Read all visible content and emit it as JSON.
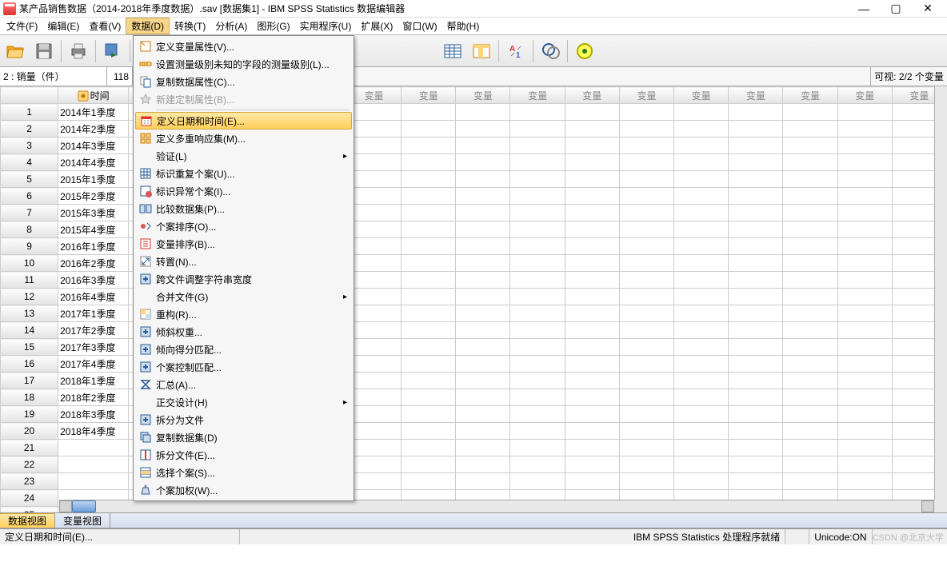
{
  "title": "某产品销售数据（2014-2018年季度数据）.sav [数据集1] - IBM SPSS Statistics 数据编辑器",
  "menubar": [
    "文件(F)",
    "编辑(E)",
    "查看(V)",
    "数据(D)",
    "转换(T)",
    "分析(A)",
    "图形(G)",
    "实用程序(U)",
    "扩展(X)",
    "窗口(W)",
    "帮助(H)"
  ],
  "locator": {
    "ref": "2 : 销量（件）",
    "val": "118",
    "vis": "可视: 2/2 个变量"
  },
  "columns": {
    "time": "时间",
    "var": "变量"
  },
  "rows": [
    "2014年1季度",
    "2014年2季度",
    "2014年3季度",
    "2014年4季度",
    "2015年1季度",
    "2015年2季度",
    "2015年3季度",
    "2015年4季度",
    "2016年1季度",
    "2016年2季度",
    "2016年3季度",
    "2016年4季度",
    "2017年1季度",
    "2017年2季度",
    "2017年3季度",
    "2017年4季度",
    "2018年1季度",
    "2018年2季度",
    "2018年3季度",
    "2018年4季度"
  ],
  "dropdown": [
    {
      "label": "定义变量属性(V)...",
      "icon": "props"
    },
    {
      "label": "设置测量级别未知的字段的测量级别(L)...",
      "icon": "ruler"
    },
    {
      "label": "复制数据属性(C)...",
      "icon": "copy"
    },
    {
      "label": "新建定制属性(B)...",
      "icon": "star",
      "disabled": true
    },
    {
      "sep": true
    },
    {
      "label": "定义日期和时间(E)...",
      "icon": "calendar",
      "highlight": true
    },
    {
      "label": "定义多重响应集(M)...",
      "icon": "multi"
    },
    {
      "label": "验证(L)",
      "sub": true,
      "noicon": true
    },
    {
      "label": "标识重复个案(U)...",
      "icon": "grid"
    },
    {
      "label": "标识异常个案(I)...",
      "icon": "warn"
    },
    {
      "label": "比较数据集(P)...",
      "icon": "compare"
    },
    {
      "label": "个案排序(O)...",
      "icon": "sort"
    },
    {
      "label": "变量排序(B)...",
      "icon": "sortv"
    },
    {
      "label": "转置(N)...",
      "icon": "transpose"
    },
    {
      "label": "跨文件调整字符串宽度",
      "icon": "plus"
    },
    {
      "label": "合并文件(G)",
      "sub": true,
      "noicon": true
    },
    {
      "label": "重构(R)...",
      "icon": "restruct"
    },
    {
      "label": "倾斜权重...",
      "icon": "plus"
    },
    {
      "label": "倾向得分匹配...",
      "icon": "plus"
    },
    {
      "label": "个案控制匹配...",
      "icon": "plus"
    },
    {
      "label": "汇总(A)...",
      "icon": "agg"
    },
    {
      "label": "正交设计(H)",
      "sub": true,
      "noicon": true
    },
    {
      "label": "拆分为文件",
      "icon": "plus"
    },
    {
      "label": "复制数据集(D)",
      "icon": "copyds"
    },
    {
      "label": "拆分文件(E)...",
      "icon": "split"
    },
    {
      "label": "选择个案(S)...",
      "icon": "select"
    },
    {
      "label": "个案加权(W)...",
      "icon": "weight"
    }
  ],
  "tabs": {
    "data": "数据视图",
    "var": "变量视图"
  },
  "status": {
    "desc": "定义日期和时间(E)...",
    "proc": "IBM SPSS Statistics 处理程序就绪",
    "unicode": "Unicode:ON",
    "watermark": "CSDN @北京大学"
  }
}
